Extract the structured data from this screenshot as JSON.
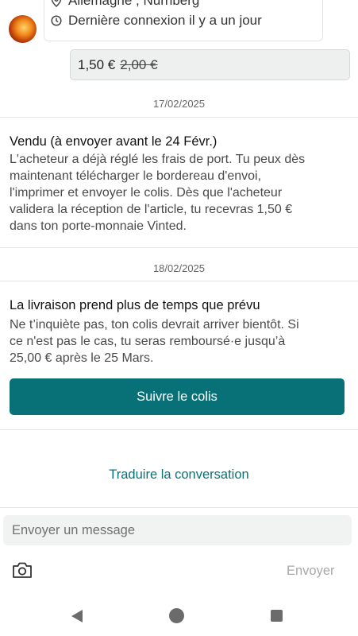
{
  "seller": {
    "location": "Allemagne , Nürnberg",
    "last_seen": "Dernière connexion il y a un jour",
    "location_icon": "location-pin-icon",
    "clock_icon": "clock-icon"
  },
  "offer": {
    "price": "1,50 €",
    "original_price": "2,00 €"
  },
  "events": [
    {
      "date": "17/02/2025",
      "title": "Vendu (à envoyer avant le 24 Févr.)",
      "lines": [
        "L'acheteur a déjà réglé les frais de port. Tu peux dès",
        "maintenant télécharger le bordereau d'envoi,",
        "l'imprimer et envoyer le colis. Dès que l'acheteur",
        "validera la réception de l'article, tu recevras 1,50 €",
        "dans ton porte-monnaie Vinted."
      ]
    },
    {
      "date": "18/02/2025",
      "title": "La livraison prend plus de temps que prévu",
      "lines": [
        "Ne t’inquiète pas, ton colis devrait arriver bientôt. Si",
        "ce n'est pas le cas, tu seras remboursé·e jusqu’à",
        "25,00 € après le 25 Mars."
      ],
      "button": "Suivre le colis"
    }
  ],
  "translate_link": "Traduire la conversation",
  "composer": {
    "placeholder": "Envoyer un message",
    "send_label": "Envoyer",
    "camera_icon": "camera-icon"
  },
  "nav": {
    "back_icon": "back-triangle-icon",
    "home_icon": "home-circle-icon",
    "recents_icon": "recents-square-icon"
  },
  "colors": {
    "accent": "#087178",
    "bubble": "#eef0f0",
    "muted": "#707070"
  }
}
